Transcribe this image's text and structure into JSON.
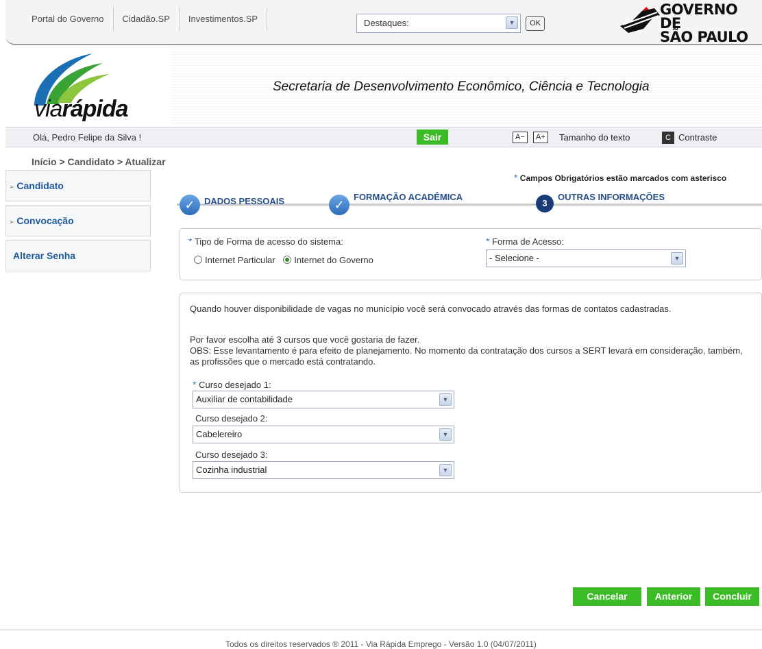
{
  "top": {
    "links": [
      "Portal do Governo",
      "Cidadão.SP",
      "Investimentos.SP"
    ],
    "destaques_value": "Destaques:",
    "ok_label": "OK",
    "gov_logo_line1": "GOVERNO DE",
    "gov_logo_line2": "SÃO PAULO"
  },
  "header": {
    "logo_text_light": "via",
    "logo_text_bold": "rápida",
    "secretaria": "Secretaria de Desenvolvimento Econômico, Ciência e Tecnologia"
  },
  "userbar": {
    "greeting": "Olá, Pedro Felipe da Silva !",
    "logout_label": "Sair",
    "decrease_text": "A−",
    "increase_text": "A+",
    "text_size_label": "Tamanho do texto",
    "contrast_icon": "C",
    "contrast_label": "Contraste"
  },
  "breadcrumb": "Início > Candidato > Atualizar",
  "sidebar": {
    "items": [
      "Candidato",
      "Convocação",
      "Alterar Senha"
    ]
  },
  "required_note": "Campos Obrigatórios estão marcados com asterisco",
  "steps": [
    {
      "label": "DADOS PESSOAIS",
      "status": "done"
    },
    {
      "label": "FORMAÇÃO ACADÊMICA",
      "status": "done"
    },
    {
      "label": "OUTRAS INFORMAÇÕES",
      "status": "current",
      "number": "3"
    }
  ],
  "access": {
    "type_label": "Tipo de Forma de acesso do sistema:",
    "option_private": "Internet Particular",
    "option_gov": "Internet do Governo",
    "selected": "Internet do Governo",
    "form_label": "Forma de Acesso:",
    "form_value": "- Selecione -"
  },
  "courses": {
    "intro": "Quando houver disponibilidade de vagas no município você será convocado através das formas de contatos cadastradas.",
    "choose": "Por favor escolha até 3 cursos que você gostaria de fazer.",
    "obs": "OBS: Esse levantamento é para efeito de planejamento. No momento da contratação dos cursos a SERT levará em consideração, também, as profissões que o mercado está contratando.",
    "course1_label": "Curso desejado 1:",
    "course1_value": "Auxiliar de contabilidade",
    "course2_label": "Curso desejado 2:",
    "course2_value": "Cabelereiro",
    "course3_label": "Curso desejado 3:",
    "course3_value": "Cozinha industrial"
  },
  "actions": {
    "cancel": "Cancelar",
    "previous": "Anterior",
    "finish": "Concluir"
  },
  "footer": "Todos os direitos reservados ® 2011 - Via Rápida Emprego - Versão 1.0 (04/07/2011)",
  "colors": {
    "accent_green": "#3bbb26",
    "link_blue": "#1e5a9c",
    "step_blue": "#1b3a78"
  }
}
